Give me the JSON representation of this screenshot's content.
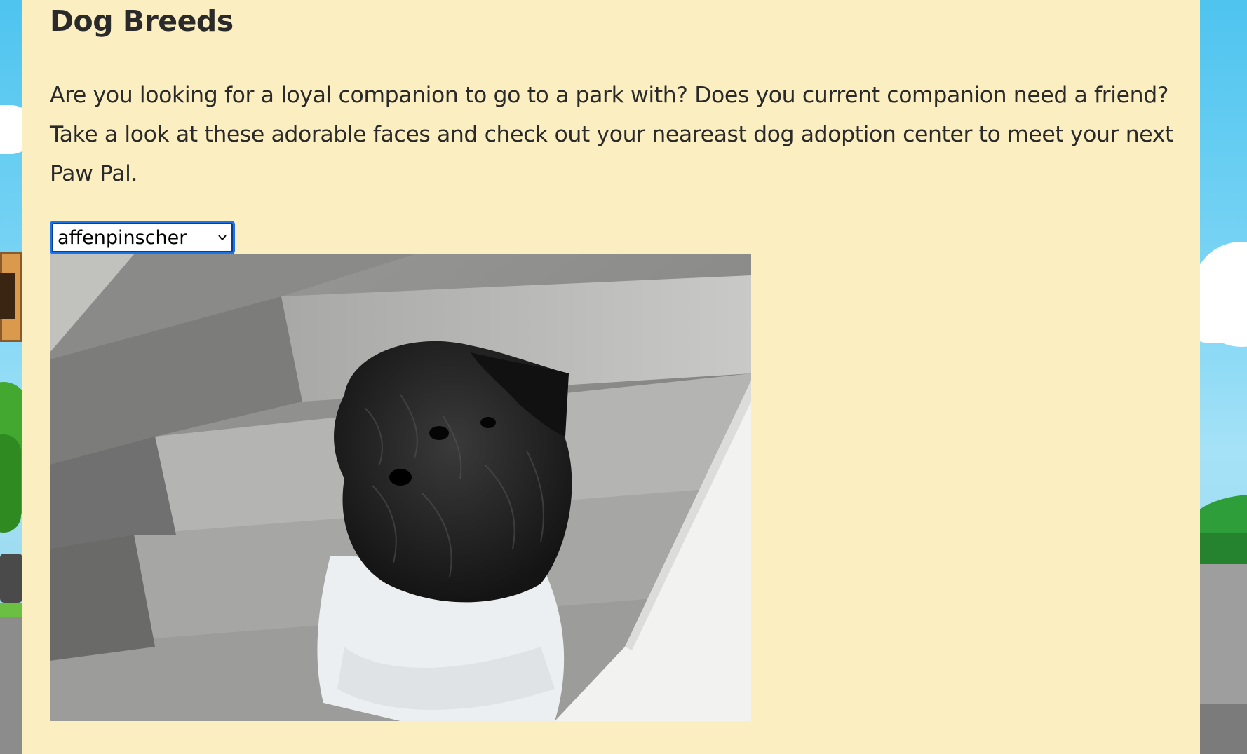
{
  "page": {
    "title": "Dog Breeds",
    "intro": "Are you looking for a loyal companion to go to a park with? Does you current companion need a friend? Take a look at these adorable faces and check out your neareast dog adoption center to meet your next Paw Pal."
  },
  "breed_select": {
    "selected": "affenpinscher"
  },
  "photo": {
    "subject": "affenpinscher"
  },
  "colors": {
    "panel_background": "#fbeec1",
    "sky": "#4ec4ef",
    "select_focus_border": "#1a73e8"
  }
}
